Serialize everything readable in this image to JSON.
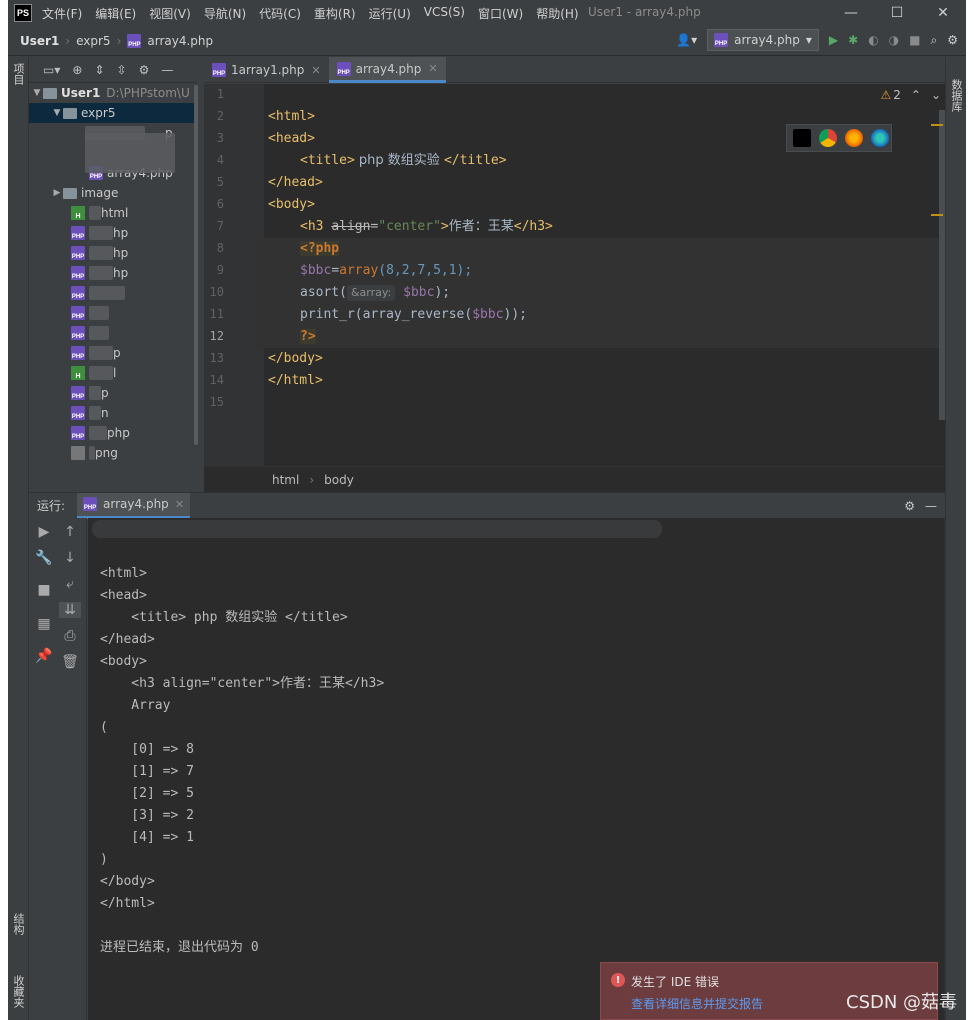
{
  "titlebar": {
    "logo": "PS",
    "menu": [
      "文件(F)",
      "编辑(E)",
      "视图(V)",
      "导航(N)",
      "代码(C)",
      "重构(R)",
      "运行(U)",
      "VCS(S)",
      "窗口(W)",
      "帮助(H)"
    ],
    "title": "User1 - array4.php",
    "minimize": "—",
    "maximize": "☐",
    "close": "✕"
  },
  "navbar": {
    "project": "User1",
    "folder": "expr5",
    "file": "array4.php",
    "run_config": "array4.php",
    "file_icon_label": "PHP"
  },
  "left_strip": {
    "project_tab": "项目",
    "structure_tab": "结构",
    "favorites_tab": "收藏夹"
  },
  "right_strip": {
    "database_tab": "数据库"
  },
  "project_tree": {
    "root_name": "User1",
    "root_path": "D:\\PHPstom\\U",
    "expr5": "expr5",
    "array4": "array4.php",
    "image": "image",
    "partial_items": [
      "p",
      "html",
      "hp",
      "hp",
      "hp",
      "p",
      "l",
      "p",
      "n",
      "php",
      "png"
    ]
  },
  "tabs": [
    {
      "label": "1array1.php",
      "close": "✕"
    },
    {
      "label": "array4.php",
      "close": "✕"
    }
  ],
  "editor": {
    "line_numbers": [
      "1",
      "2",
      "3",
      "4",
      "5",
      "6",
      "7",
      "8",
      "9",
      "10",
      "11",
      "12",
      "13",
      "14",
      "15"
    ],
    "warnings": "2",
    "lines": {
      "l2": "<html>",
      "l3": "<head>",
      "l4_open": "<title>",
      "l4_text": " php 数组实验 ",
      "l4_close": "</title>",
      "l5": "</head>",
      "l6": "<body>",
      "l7_tag": "<h3 ",
      "l7_attr": "align",
      "l7_eq": "=",
      "l7_val": "\"center\"",
      "l7_gt": ">",
      "l7_text": "作者：王某",
      "l7_close": "</h3>",
      "l8": "<?php",
      "l9_var": "$bbc",
      "l9_eq": "=",
      "l9_fn": "array",
      "l9_args": "(8,2,7,5,1);",
      "l10_fn": "asort(",
      "l10_hint": "&array:",
      "l10_var": "$bbc",
      "l10_end": ");",
      "l11_a": "print_r(array_reverse(",
      "l11_var": "$bbc",
      "l11_end": "));",
      "l12": "?>",
      "l13": "</body>",
      "l14": "</html>"
    }
  },
  "breadcrumbs": [
    "html",
    "body"
  ],
  "run_panel": {
    "label": "运行:",
    "tab": "array4.php",
    "tab_close": "✕",
    "console": [
      "<html>",
      "<head>",
      "    <title> php 数组实验 </title>",
      "</head>",
      "<body>",
      "    <h3 align=\"center\">作者：王某</h3>",
      "    Array",
      "(",
      "    [0] => 8",
      "    [1] => 7",
      "    [2] => 5",
      "    [3] => 2",
      "    [4] => 1",
      ")",
      "</body>",
      "</html>",
      "",
      "进程已结束，退出代码为 0"
    ]
  },
  "ide_error": {
    "title": "发生了 IDE 错误",
    "link": "查看详细信息并提交报告"
  },
  "watermark": "CSDN @菇毒"
}
